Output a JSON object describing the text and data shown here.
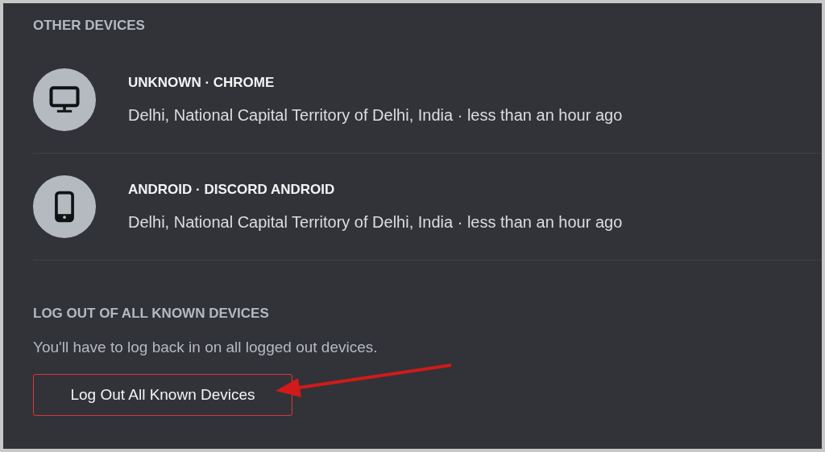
{
  "other_devices": {
    "heading": "OTHER DEVICES",
    "devices": [
      {
        "kind": "desktop",
        "title": "UNKNOWN · CHROME",
        "location": "Delhi, National Capital Territory of Delhi, India · less than an hour ago"
      },
      {
        "kind": "mobile",
        "title": "ANDROID · DISCORD ANDROID",
        "location": "Delhi, National Capital Territory of Delhi, India · less than an hour ago"
      }
    ]
  },
  "log_out_all": {
    "heading": "LOG OUT OF ALL KNOWN DEVICES",
    "description": "You'll have to log back in on all logged out devices.",
    "button": "Log Out All Known Devices"
  }
}
